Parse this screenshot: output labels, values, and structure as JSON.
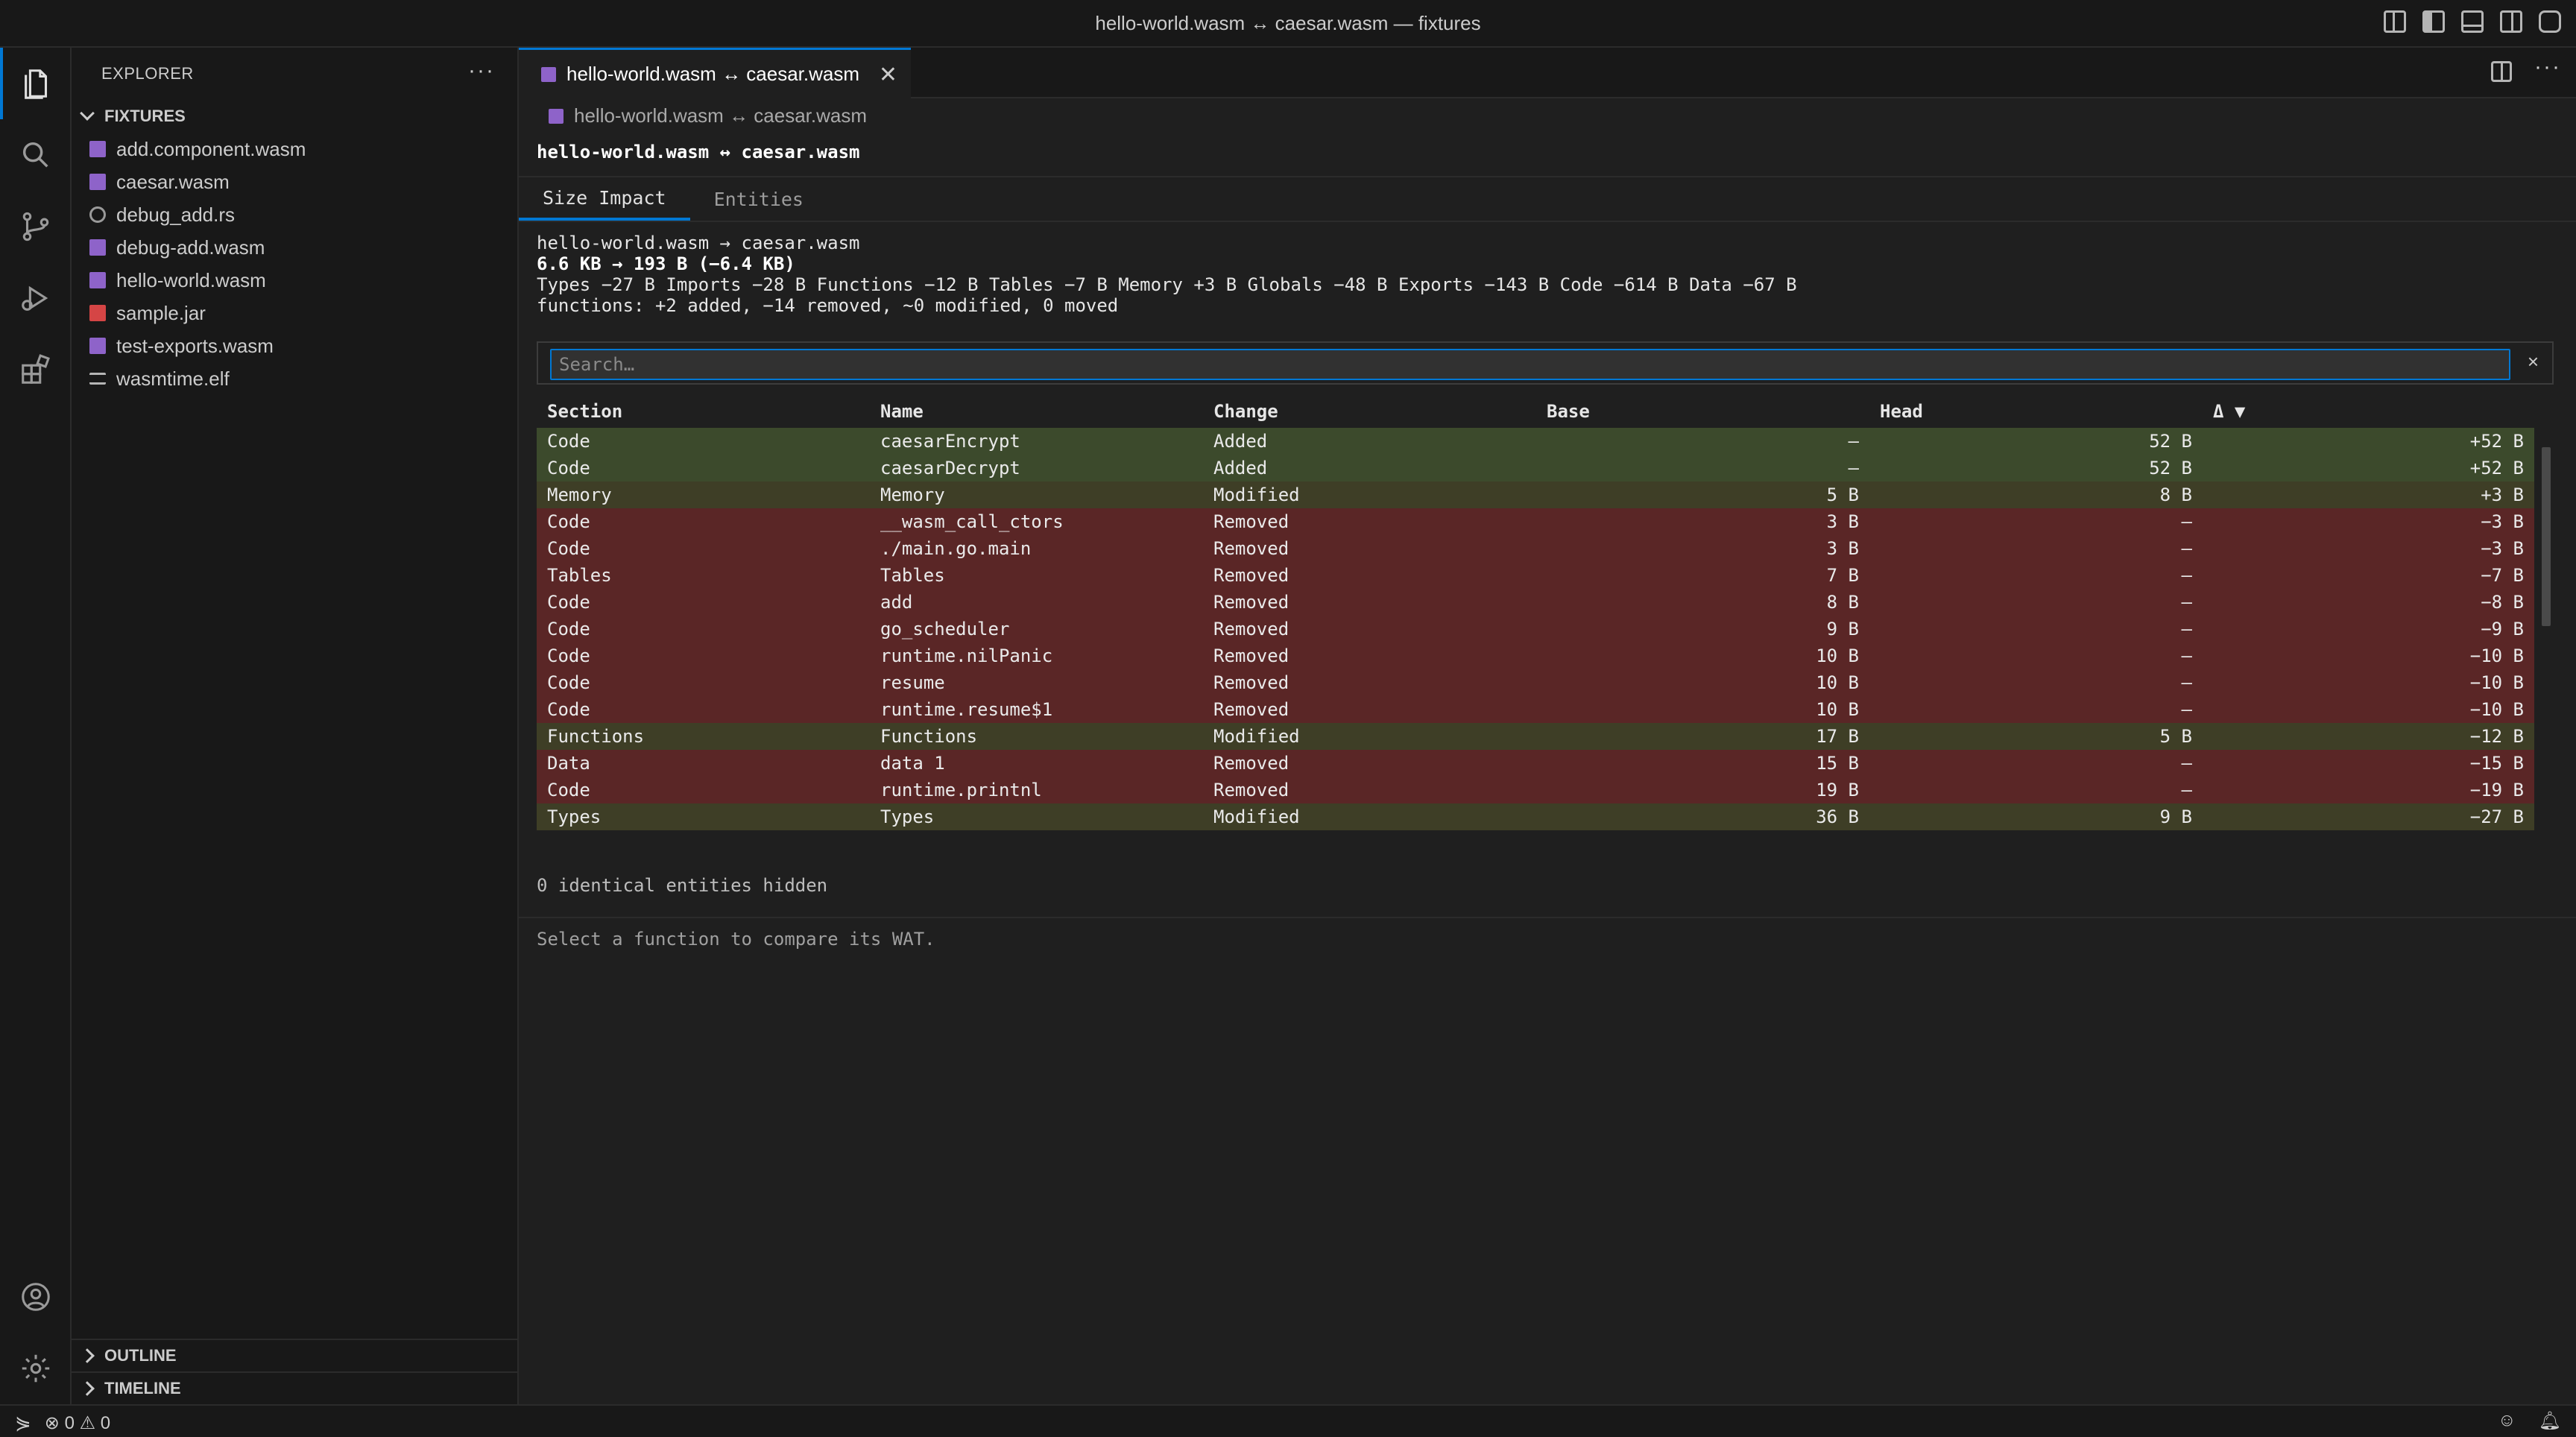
{
  "window": {
    "title": "hello-world.wasm ↔ caesar.wasm — fixtures"
  },
  "activity_bar": {
    "items": [
      "explorer-icon",
      "search-icon",
      "source-control-icon",
      "run-debug-icon",
      "extensions-icon"
    ],
    "bottom": [
      "account-icon",
      "settings-gear-icon"
    ]
  },
  "sidebar": {
    "header": "EXPLORER",
    "more": "···",
    "folder": "FIXTURES",
    "files": [
      {
        "name": "add.component.wasm",
        "type": "wasm"
      },
      {
        "name": "caesar.wasm",
        "type": "wasm"
      },
      {
        "name": "debug_add.rs",
        "type": "rs"
      },
      {
        "name": "debug-add.wasm",
        "type": "wasm"
      },
      {
        "name": "hello-world.wasm",
        "type": "wasm"
      },
      {
        "name": "sample.jar",
        "type": "jar"
      },
      {
        "name": "test-exports.wasm",
        "type": "wasm"
      },
      {
        "name": "wasmtime.elf",
        "type": "elf"
      }
    ],
    "outline": "OUTLINE",
    "timeline": "TIMELINE"
  },
  "editor": {
    "tab_label": "hello-world.wasm ↔ caesar.wasm",
    "tab_close": "✕",
    "more": "···",
    "breadcrumb": "hello-world.wasm ↔ caesar.wasm",
    "doc_title": "hello-world.wasm ↔ caesar.wasm",
    "view_tabs": [
      "Size Impact",
      "Entities"
    ],
    "summary": {
      "line1": "hello-world.wasm → caesar.wasm",
      "line2": "6.6 KB → 193 B (−6.4 KB)",
      "line3": "Types −27 B Imports −28 B Functions −12 B Tables −7 B Memory +3 B Globals −48 B Exports −143 B Code −614 B Data −67 B",
      "line4": "functions: +2 added, −14 removed, ~0 modified, 0 moved"
    },
    "search": {
      "placeholder": "Search…",
      "value": "",
      "clear": "×"
    },
    "table": {
      "columns": [
        "Section",
        "Name",
        "Change",
        "Base",
        "Head",
        "Δ ▼"
      ],
      "rows": [
        {
          "section": "Code",
          "name": "caesarEncrypt",
          "change": "Added",
          "base": "—",
          "head": "52 B",
          "delta": "+52 B",
          "status": "added"
        },
        {
          "section": "Code",
          "name": "caesarDecrypt",
          "change": "Added",
          "base": "—",
          "head": "52 B",
          "delta": "+52 B",
          "status": "added"
        },
        {
          "section": "Memory",
          "name": "Memory",
          "change": "Modified",
          "base": "5 B",
          "head": "8 B",
          "delta": "+3 B",
          "status": "modified"
        },
        {
          "section": "Code",
          "name": "__wasm_call_ctors",
          "change": "Removed",
          "base": "3 B",
          "head": "—",
          "delta": "−3 B",
          "status": "removed"
        },
        {
          "section": "Code",
          "name": "./main.go.main",
          "change": "Removed",
          "base": "3 B",
          "head": "—",
          "delta": "−3 B",
          "status": "removed"
        },
        {
          "section": "Tables",
          "name": "Tables",
          "change": "Removed",
          "base": "7 B",
          "head": "—",
          "delta": "−7 B",
          "status": "removed"
        },
        {
          "section": "Code",
          "name": "add",
          "change": "Removed",
          "base": "8 B",
          "head": "—",
          "delta": "−8 B",
          "status": "removed"
        },
        {
          "section": "Code",
          "name": "go_scheduler",
          "change": "Removed",
          "base": "9 B",
          "head": "—",
          "delta": "−9 B",
          "status": "removed"
        },
        {
          "section": "Code",
          "name": "runtime.nilPanic",
          "change": "Removed",
          "base": "10 B",
          "head": "—",
          "delta": "−10 B",
          "status": "removed"
        },
        {
          "section": "Code",
          "name": "resume",
          "change": "Removed",
          "base": "10 B",
          "head": "—",
          "delta": "−10 B",
          "status": "removed"
        },
        {
          "section": "Code",
          "name": "runtime.resume$1",
          "change": "Removed",
          "base": "10 B",
          "head": "—",
          "delta": "−10 B",
          "status": "removed"
        },
        {
          "section": "Functions",
          "name": "Functions",
          "change": "Modified",
          "base": "17 B",
          "head": "5 B",
          "delta": "−12 B",
          "status": "modified"
        },
        {
          "section": "Data",
          "name": "data 1",
          "change": "Removed",
          "base": "15 B",
          "head": "—",
          "delta": "−15 B",
          "status": "removed"
        },
        {
          "section": "Code",
          "name": "runtime.printnl",
          "change": "Removed",
          "base": "19 B",
          "head": "—",
          "delta": "−19 B",
          "status": "removed"
        },
        {
          "section": "Types",
          "name": "Types",
          "change": "Modified",
          "base": "36 B",
          "head": "9 B",
          "delta": "−27 B",
          "status": "modified"
        }
      ]
    },
    "hidden_note": "0 identical entities hidden",
    "wat_note": "Select a function to compare its WAT."
  },
  "status_bar": {
    "errors": "0",
    "warnings": "0"
  },
  "colors": {
    "accent": "#0078d4",
    "added_row": "#3c4a2c",
    "modified_row": "#3e3e26",
    "removed_row": "#5a2626"
  }
}
